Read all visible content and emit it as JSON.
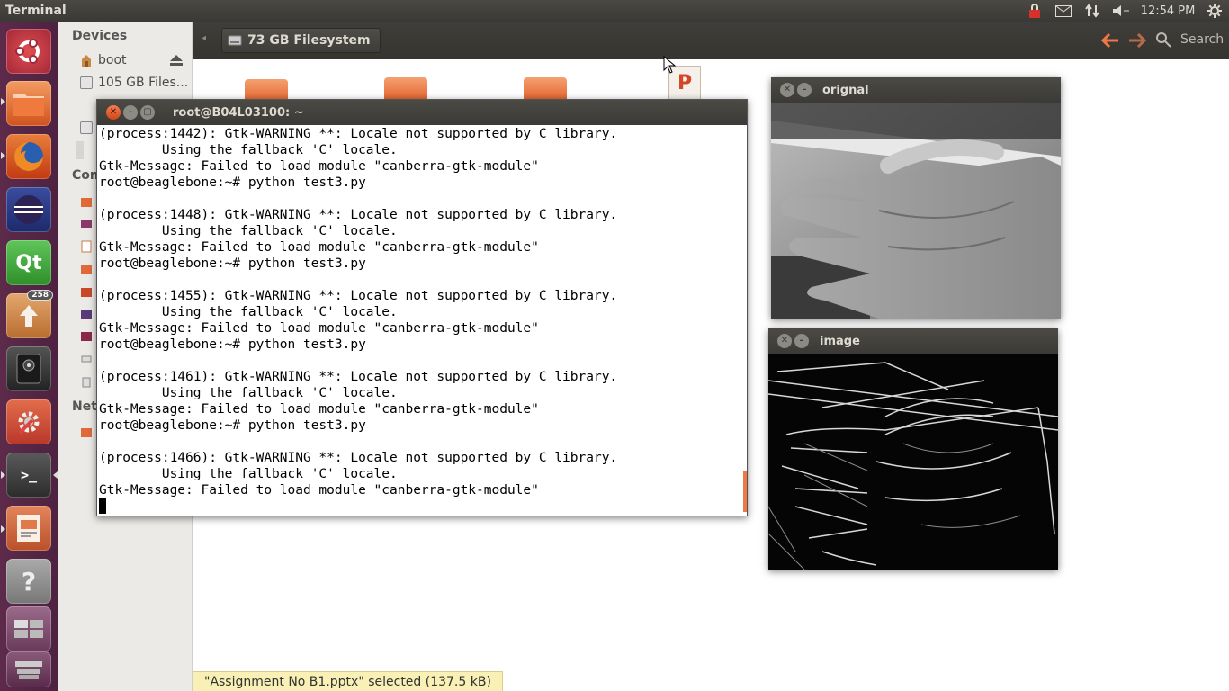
{
  "top_panel": {
    "app_title": "Terminal",
    "clock": "12:54 PM",
    "icons": [
      "lock-icon",
      "mail-icon",
      "network-icon",
      "volume-icon",
      "settings-gear-icon"
    ]
  },
  "launcher": {
    "items": [
      {
        "name": "ubuntu-dash",
        "glyph": ""
      },
      {
        "name": "files",
        "glyph": ""
      },
      {
        "name": "firefox",
        "glyph": ""
      },
      {
        "name": "eclipse",
        "glyph": ""
      },
      {
        "name": "qt-creator",
        "glyph": "Qt"
      },
      {
        "name": "software-updater",
        "glyph": "",
        "badge": "258"
      },
      {
        "name": "webcam",
        "glyph": ""
      },
      {
        "name": "system-settings",
        "glyph": ""
      },
      {
        "name": "terminal",
        "glyph": ">_"
      },
      {
        "name": "impress",
        "glyph": ""
      },
      {
        "name": "help",
        "glyph": "?"
      },
      {
        "name": "workspace-switcher",
        "glyph": ""
      }
    ]
  },
  "file_manager": {
    "sidebar": {
      "devices_heading": "Devices",
      "computer_heading": "Com",
      "network_heading": "Net",
      "devices": [
        {
          "label": "boot"
        },
        {
          "label": "105 GB Files..."
        }
      ]
    },
    "breadcrumb": "73 GB Filesystem",
    "search_label": "Search",
    "status": "\"Assignment No B1.pptx\" selected (137.5 kB)",
    "ppt_glyph": "P"
  },
  "terminal": {
    "title": "root@B04L03100: ~",
    "lines": [
      "(process:1442): Gtk-WARNING **: Locale not supported by C library.",
      "        Using the fallback 'C' locale.",
      "Gtk-Message: Failed to load module \"canberra-gtk-module\"",
      "root@beaglebone:~# python test3.py",
      "",
      "(process:1448): Gtk-WARNING **: Locale not supported by C library.",
      "        Using the fallback 'C' locale.",
      "Gtk-Message: Failed to load module \"canberra-gtk-module\"",
      "root@beaglebone:~# python test3.py",
      "",
      "(process:1455): Gtk-WARNING **: Locale not supported by C library.",
      "        Using the fallback 'C' locale.",
      "Gtk-Message: Failed to load module \"canberra-gtk-module\"",
      "root@beaglebone:~# python test3.py",
      "",
      "(process:1461): Gtk-WARNING **: Locale not supported by C library.",
      "        Using the fallback 'C' locale.",
      "Gtk-Message: Failed to load module \"canberra-gtk-module\"",
      "root@beaglebone:~# python test3.py",
      "",
      "(process:1466): Gtk-WARNING **: Locale not supported by C library.",
      "        Using the fallback 'C' locale.",
      "Gtk-Message: Failed to load module \"canberra-gtk-module\""
    ]
  },
  "image_windows": {
    "original": {
      "title": "orignal"
    },
    "processed": {
      "title": "image"
    }
  }
}
